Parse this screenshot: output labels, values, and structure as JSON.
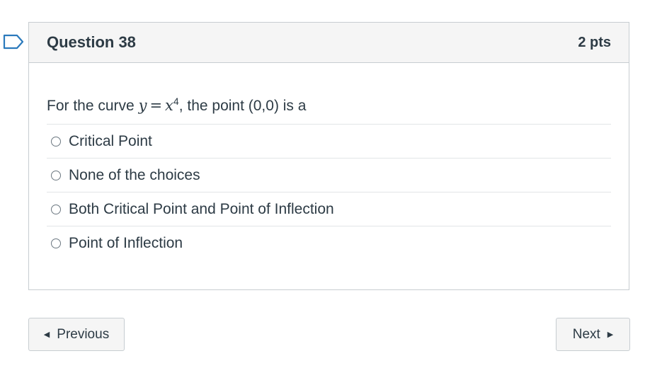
{
  "question": {
    "title": "Question 38",
    "points": "2 pts",
    "prompt_before": "For the curve ",
    "math_y": "y",
    "math_eq": "=",
    "math_x": "x",
    "math_exp": "4",
    "prompt_after": ", the point (0,0) is a"
  },
  "answers": [
    {
      "label": "Critical Point"
    },
    {
      "label": "None of the choices"
    },
    {
      "label": "Both Critical Point and Point of Inflection"
    },
    {
      "label": "Point of Inflection"
    }
  ],
  "nav": {
    "previous_label": "Previous",
    "next_label": "Next",
    "previous_icon": "caret-left-icon",
    "next_icon": "caret-right-icon"
  },
  "colors": {
    "flag_outline": "#2b7abc",
    "text": "#2d3b45",
    "border": "#c7cdd1",
    "header_bg": "#f5f5f5"
  }
}
